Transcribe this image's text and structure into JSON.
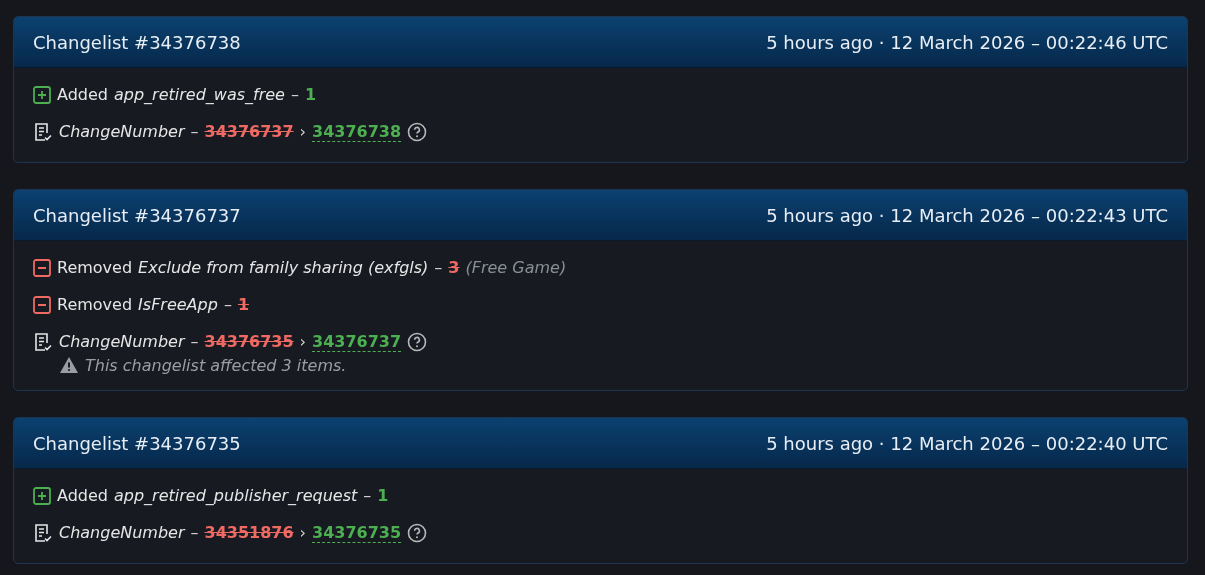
{
  "changelists": [
    {
      "title": "Changelist #34376738",
      "time": "5 hours ago · 12 March 2026 – 00:22:46 UTC",
      "entries": [
        {
          "kind": "added",
          "action": "Added",
          "key": "app_retired_was_free",
          "separator": "–",
          "value": "1"
        },
        {
          "kind": "changenumber",
          "key": "ChangeNumber",
          "separator": "–",
          "old": "34376737",
          "arrow": "›",
          "new": "34376738"
        }
      ]
    },
    {
      "title": "Changelist #34376737",
      "time": "5 hours ago · 12 March 2026 – 00:22:43 UTC",
      "entries": [
        {
          "kind": "removed",
          "action": "Removed",
          "key": "Exclude from family sharing (exfgls)",
          "separator": "–",
          "value": "3",
          "note": "(Free Game)"
        },
        {
          "kind": "removed",
          "action": "Removed",
          "key": "IsFreeApp",
          "separator": "–",
          "value": "1"
        },
        {
          "kind": "changenumber",
          "key": "ChangeNumber",
          "separator": "–",
          "old": "34376735",
          "arrow": "›",
          "new": "34376737",
          "warning": "This changelist affected 3 items."
        }
      ]
    },
    {
      "title": "Changelist #34376735",
      "time": "5 hours ago · 12 March 2026 – 00:22:40 UTC",
      "entries": [
        {
          "kind": "added",
          "action": "Added",
          "key": "app_retired_publisher_request",
          "separator": "–",
          "value": "1"
        },
        {
          "kind": "changenumber",
          "key": "ChangeNumber",
          "separator": "–",
          "old": "34351876",
          "arrow": "›",
          "new": "34376735"
        }
      ]
    }
  ]
}
